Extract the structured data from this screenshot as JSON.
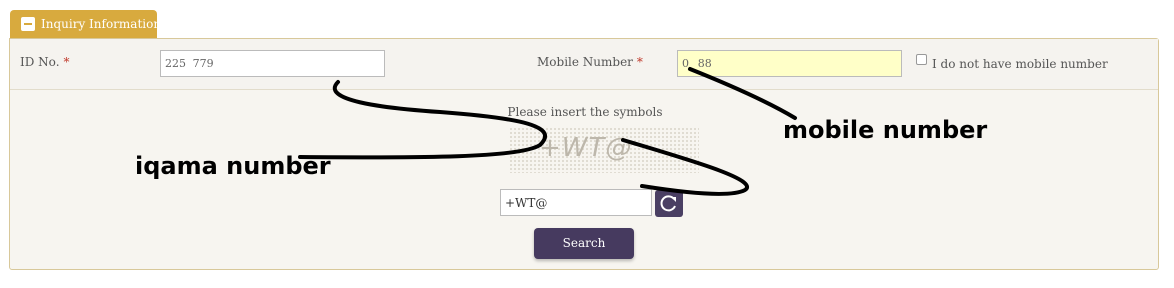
{
  "tab": {
    "title": "Inquiry Information"
  },
  "form": {
    "id_label": "ID No.",
    "id_value": "225   779",
    "mobile_label": "Mobile Number",
    "mobile_value": "0    88",
    "required_mark": "*",
    "no_mobile_label": "I do not have mobile number",
    "captcha_prompt": "Please insert the symbols",
    "captcha_image_text": "+WT@",
    "captcha_value": "+WT@",
    "search_label": "Search"
  },
  "annotations": {
    "iqama": "iqama number",
    "mobile": "mobile number"
  },
  "colors": {
    "tab": "#d8aa3e",
    "button": "#463a5f",
    "highlight_input": "#ffffc8"
  }
}
